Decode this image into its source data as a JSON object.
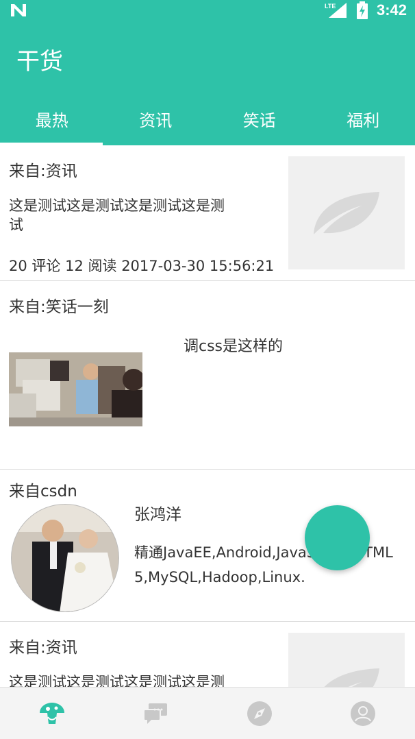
{
  "status_bar": {
    "network": "LTE",
    "time": "3:42"
  },
  "app": {
    "title": "干货"
  },
  "tabs": [
    {
      "label": "最热",
      "active": true
    },
    {
      "label": "资讯",
      "active": false
    },
    {
      "label": "笑话",
      "active": false
    },
    {
      "label": "福利",
      "active": false
    }
  ],
  "feed": [
    {
      "source": "来自:资讯",
      "text_line1": "这是测试这是测试这是测试这是测",
      "text_line2": "试",
      "comments": "20 评论",
      "reads": "12 阅读",
      "datetime": "2017-03-30 15:56:21",
      "thumbnail": "leaf-placeholder-icon"
    },
    {
      "source": "来自:笑话一刻",
      "caption": "调css是这样的",
      "image": "office-scene-photo"
    },
    {
      "source": "来自csdn",
      "name": "张鸿洋",
      "desc_line1": "精通JavaEE,Android,JavaScript,HTML",
      "desc_line2": "5,MySQL,Hadoop,Linux.",
      "avatar": "wedding-photo-avatar"
    },
    {
      "source": "来自:资讯",
      "text_line1": "这是测试这是测试这是测试这是测",
      "thumbnail": "leaf-placeholder-icon"
    }
  ],
  "bottom_nav": [
    {
      "icon": "mushroom-home-icon",
      "active": true
    },
    {
      "icon": "chat-bubbles-icon",
      "active": false
    },
    {
      "icon": "compass-icon",
      "active": false
    },
    {
      "icon": "profile-icon",
      "active": false
    }
  ],
  "colors": {
    "primary": "#2ec2a8",
    "text": "#333333",
    "divider": "#dcdcdc",
    "inactive_icon": "#c8c8c8"
  }
}
